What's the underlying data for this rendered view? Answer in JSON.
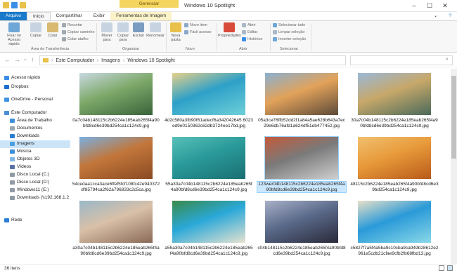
{
  "window": {
    "title": "Windows 10 Spotlight",
    "contextual_tab": "Gerenciar"
  },
  "tabs": [
    "Arquivo",
    "Início",
    "Compartilhar",
    "Exibir",
    "Ferramentas de Imagem"
  ],
  "ribbon": {
    "pin": "Fixar no Acesso rápido",
    "copy": "Copiar",
    "paste": "Colar",
    "cut": "Recortar",
    "copy_path": "Copiar caminho",
    "paste_shortcut": "Colar atalho",
    "move_to": "Mover para",
    "copy_to": "Copiar para",
    "delete": "Excluir",
    "rename": "Renomear",
    "new_folder": "Nova pasta",
    "new_item": "Novo item",
    "easy_access": "Fácil acesso",
    "properties": "Propriedades",
    "open": "Abrir",
    "edit": "Editar",
    "history": "Histórico",
    "select_all": "Selecionar tudo",
    "select_none": "Limpar seleção",
    "invert_selection": "Inverter seleção",
    "groups": {
      "clipboard": "Área de Transferência",
      "organize": "Organizar",
      "new": "Novo",
      "open": "Abrir",
      "select": "Selecionar"
    }
  },
  "address": {
    "crumbs": [
      "Este Computador",
      "Imagens",
      "Windows 10 Spotlight"
    ]
  },
  "nav": {
    "items": [
      {
        "label": "Acesso rápido",
        "color": "#3a8ee6"
      },
      {
        "label": "Dropbox",
        "color": "#1c6fd1"
      },
      {
        "label": "OneDrive - Personal",
        "color": "#3f93e0"
      },
      {
        "label": "Este Computador",
        "color": "#4a8fd6"
      },
      {
        "label": "Área de Trabalho",
        "color": "#3c8fdc"
      },
      {
        "label": "Documentos",
        "color": "#9aa4ad"
      },
      {
        "label": "Downloads",
        "color": "#2a7fd4"
      },
      {
        "label": "Imagens",
        "color": "#4aa0e0"
      },
      {
        "label": "Música",
        "color": "#3c8fdc"
      },
      {
        "label": "Objetos 3D",
        "color": "#7fb6e6"
      },
      {
        "label": "Vídeos",
        "color": "#5a6fa8"
      },
      {
        "label": "Disco Local (C:)",
        "color": "#8f9aa5"
      },
      {
        "label": "Disco Local (D:)",
        "color": "#8f9aa5"
      },
      {
        "label": "Windows11 (E:)",
        "color": "#8f9aa5"
      },
      {
        "label": "Downloads (\\\\192.168.1.2",
        "color": "#8f9aa5"
      },
      {
        "label": "Rede",
        "color": "#2a7fd4"
      }
    ]
  },
  "files": [
    {
      "name": "0a7c04b148115c2b6224e185eab265f4a90bfd8cd6e39bd254ca1c124c9.jpg",
      "colors": [
        "#7ea96a",
        "#39633a",
        "#c8d9e2"
      ]
    },
    {
      "name": "4d2c580a3fb90f61adecf6a342042645 6023ed9e0150362c62db3724ee17bd.jpg",
      "colors": [
        "#2ea0c8",
        "#6ed0d8",
        "#e6d08a"
      ]
    },
    {
      "name": "05a3ce76ffb52dd2f1a84a5ae628b643a7ec29e6db76afd1a624df51eb477452.jpg",
      "colors": [
        "#e2a25a",
        "#5d4a3a",
        "#8ab0d0"
      ]
    },
    {
      "name": "30a7c04b148115c2b6224e185eab265f4a90bfd8cd6e39bd254ca1c124c9.jpg",
      "colors": [
        "#c7a86a",
        "#4a6a5a",
        "#9ab8d8"
      ]
    },
    {
      "name": "54cedaa1cca3ace6ffef5fcf108fc42e940372df85794ca2f62a796833c2c5ca.jpg",
      "colors": [
        "#c2763a",
        "#8a4a22",
        "#7ab0e0"
      ]
    },
    {
      "name": "55a30a7c04b148115c2b6224e185eab265f4a90bfd8cd6e39bd254ca1c124c9.jpg",
      "colors": [
        "#2a9a9a",
        "#1a6f72",
        "#58c0b8"
      ]
    },
    {
      "name": "123wer04b148115c2b6224e185eab265f4a90bfd8cd6e39bd254ca1c124c9.jpg",
      "colors": [
        "#7a7a7a",
        "#cfcfcf",
        "#c45a3a"
      ]
    },
    {
      "name": "48115c2b6224e185eab265f4a90bfd8cd6e39bd254ca1c124c9.jpg",
      "colors": [
        "#e89a3a",
        "#b85a1a",
        "#f0c070"
      ]
    },
    {
      "name": "a30a7c04b148115c2b6224e185eab265f4a90bfd8cd6e39bd254ca1c124c9.jpg",
      "colors": [
        "#d9c0a8",
        "#8a6a58",
        "#9ab8c8"
      ]
    },
    {
      "name": "a55a30a7c04b148115c2b6224e185eab265f4a90bfd8cd6e39bd254ca1c124c9.jpg",
      "colors": [
        "#2aa8d8",
        "#e6e2d0",
        "#3a8a4a"
      ]
    },
    {
      "name": "c04b148115c2b6224e185eab265f4a90bfd8cd6e39bd254ca1c124c9.jpg",
      "colors": [
        "#5a6a8a",
        "#2a2a3a",
        "#a8b0c8"
      ]
    },
    {
      "name": "c5827f7a5f4a5ba9c10cba9ca949b28612e2961e5cdb21cfae9cfb2fb68fbd13.jpg",
      "colors": [
        "#2a9ad8",
        "#8ad8e8",
        "#e8e0c8"
      ]
    }
  ],
  "status": {
    "count": "36 itens"
  }
}
